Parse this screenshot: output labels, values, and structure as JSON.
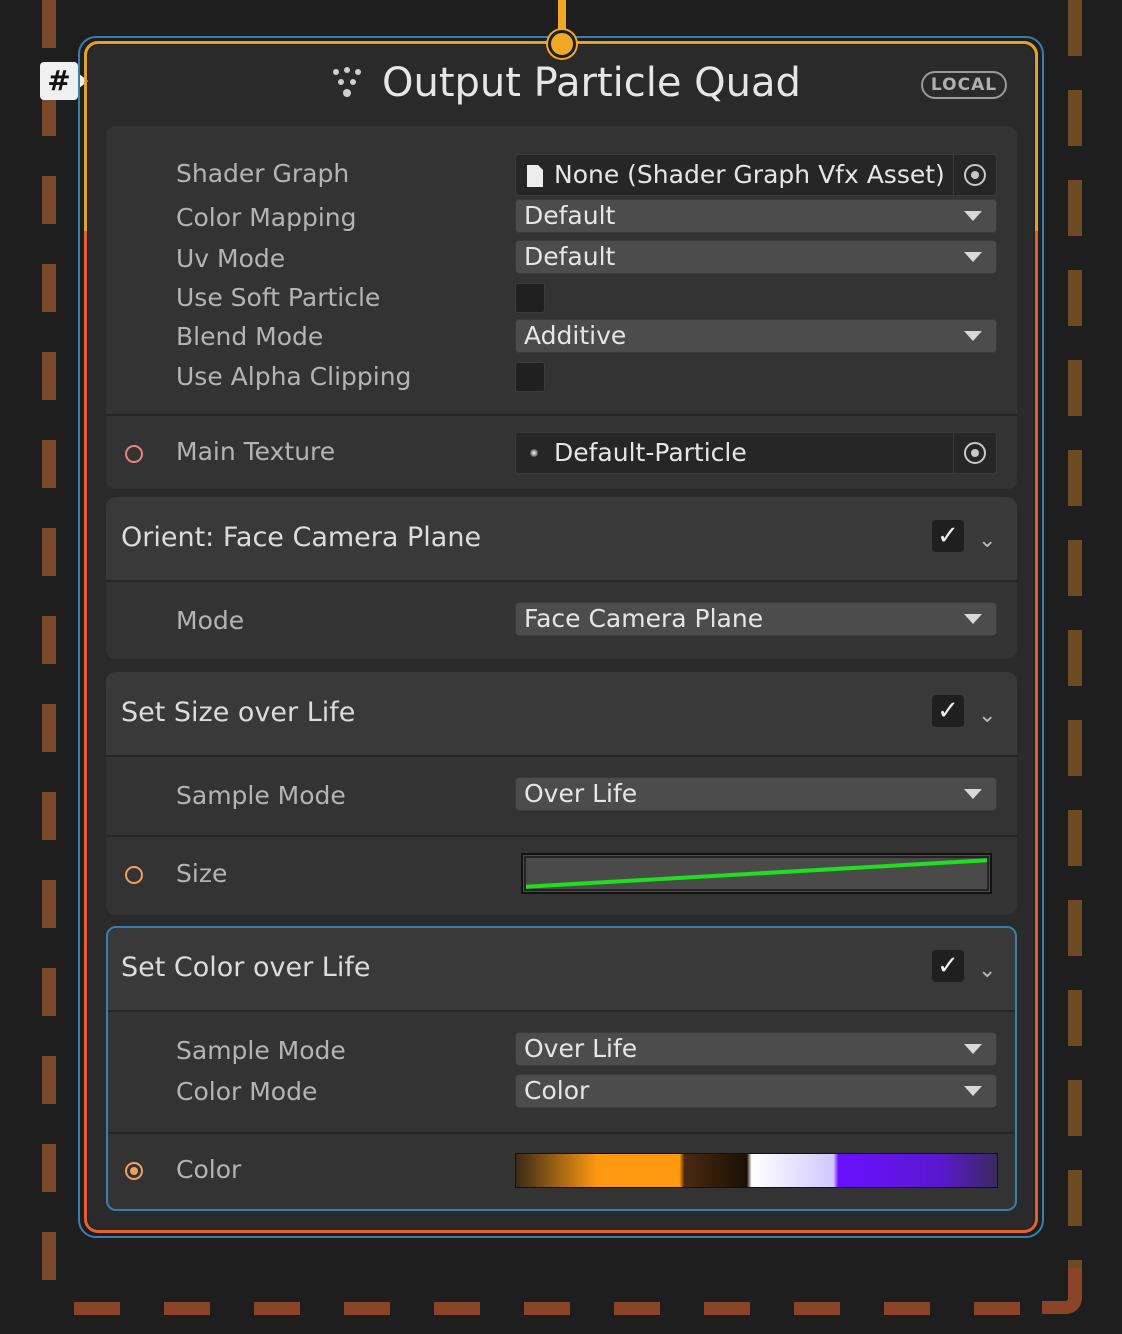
{
  "group": {
    "badge": "#"
  },
  "node": {
    "title": "Output Particle Quad",
    "badge": "LOCAL",
    "settings": {
      "shader_graph": {
        "label": "Shader Graph",
        "value": "None (Shader Graph Vfx Asset)"
      },
      "color_mapping": {
        "label": "Color Mapping",
        "value": "Default"
      },
      "uv_mode": {
        "label": "Uv Mode",
        "value": "Default"
      },
      "use_soft_particle": {
        "label": "Use Soft Particle",
        "checked": false
      },
      "blend_mode": {
        "label": "Blend Mode",
        "value": "Additive"
      },
      "use_alpha_clipping": {
        "label": "Use Alpha Clipping",
        "checked": false
      }
    },
    "main_texture": {
      "label": "Main Texture",
      "value": "Default-Particle",
      "port_color": "#f08080"
    }
  },
  "blocks": {
    "orient": {
      "title": "Orient: Face Camera Plane",
      "enabled": true,
      "mode": {
        "label": "Mode",
        "value": "Face Camera Plane"
      }
    },
    "size": {
      "title": "Set Size over Life",
      "enabled": true,
      "sample_mode": {
        "label": "Sample Mode",
        "value": "Over Life"
      },
      "curve": {
        "label": "Size",
        "port_color": "#f0a060",
        "curve_color": "#1ee01e",
        "start": 0.1,
        "end": 0.9
      }
    },
    "color": {
      "title": "Set Color over Life",
      "enabled": true,
      "sample_mode": {
        "label": "Sample Mode",
        "value": "Over Life"
      },
      "color_mode": {
        "label": "Color Mode",
        "value": "Color"
      },
      "gradient": {
        "label": "Color",
        "port_color": "#f0a060",
        "stops": [
          "#3a2a18",
          "#ff9a10",
          "#ff9a10",
          "#4a2a10",
          "#1a1005",
          "#ffffff",
          "#d0c8ff",
          "#6a10ff",
          "#5a18d0",
          "#3a2a60"
        ]
      }
    }
  },
  "colors": {
    "accent_gold": "#e0a326",
    "accent_orange": "#e5602f",
    "selection_blue": "#3a7db0"
  },
  "icons": {
    "title": "particle-quad-icon",
    "check": "checkmark-icon",
    "chevron": "chevron-down-icon",
    "picker": "object-picker-icon"
  }
}
